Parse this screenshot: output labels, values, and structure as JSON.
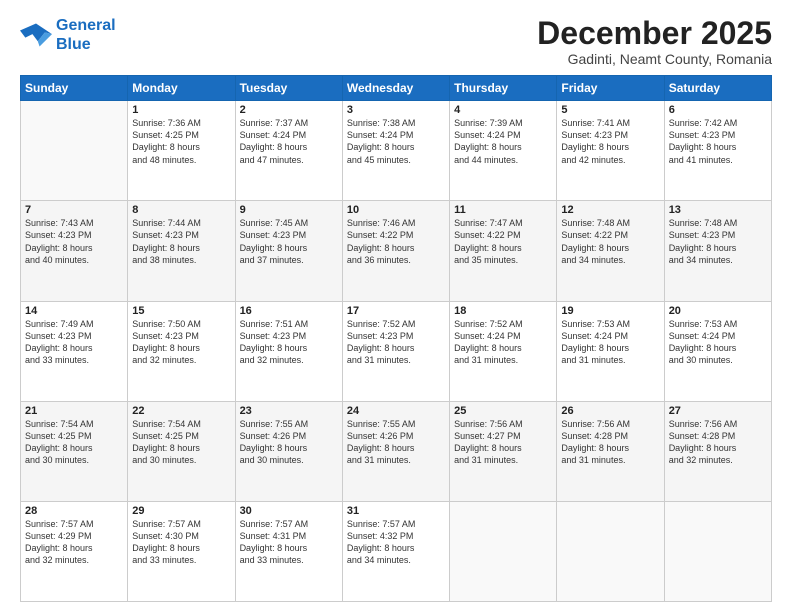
{
  "logo": {
    "line1": "General",
    "line2": "Blue"
  },
  "title": "December 2025",
  "subtitle": "Gadinti, Neamt County, Romania",
  "days_header": [
    "Sunday",
    "Monday",
    "Tuesday",
    "Wednesday",
    "Thursday",
    "Friday",
    "Saturday"
  ],
  "weeks": [
    [
      {
        "num": "",
        "info": ""
      },
      {
        "num": "1",
        "info": "Sunrise: 7:36 AM\nSunset: 4:25 PM\nDaylight: 8 hours\nand 48 minutes."
      },
      {
        "num": "2",
        "info": "Sunrise: 7:37 AM\nSunset: 4:24 PM\nDaylight: 8 hours\nand 47 minutes."
      },
      {
        "num": "3",
        "info": "Sunrise: 7:38 AM\nSunset: 4:24 PM\nDaylight: 8 hours\nand 45 minutes."
      },
      {
        "num": "4",
        "info": "Sunrise: 7:39 AM\nSunset: 4:24 PM\nDaylight: 8 hours\nand 44 minutes."
      },
      {
        "num": "5",
        "info": "Sunrise: 7:41 AM\nSunset: 4:23 PM\nDaylight: 8 hours\nand 42 minutes."
      },
      {
        "num": "6",
        "info": "Sunrise: 7:42 AM\nSunset: 4:23 PM\nDaylight: 8 hours\nand 41 minutes."
      }
    ],
    [
      {
        "num": "7",
        "info": "Sunrise: 7:43 AM\nSunset: 4:23 PM\nDaylight: 8 hours\nand 40 minutes."
      },
      {
        "num": "8",
        "info": "Sunrise: 7:44 AM\nSunset: 4:23 PM\nDaylight: 8 hours\nand 38 minutes."
      },
      {
        "num": "9",
        "info": "Sunrise: 7:45 AM\nSunset: 4:23 PM\nDaylight: 8 hours\nand 37 minutes."
      },
      {
        "num": "10",
        "info": "Sunrise: 7:46 AM\nSunset: 4:22 PM\nDaylight: 8 hours\nand 36 minutes."
      },
      {
        "num": "11",
        "info": "Sunrise: 7:47 AM\nSunset: 4:22 PM\nDaylight: 8 hours\nand 35 minutes."
      },
      {
        "num": "12",
        "info": "Sunrise: 7:48 AM\nSunset: 4:22 PM\nDaylight: 8 hours\nand 34 minutes."
      },
      {
        "num": "13",
        "info": "Sunrise: 7:48 AM\nSunset: 4:23 PM\nDaylight: 8 hours\nand 34 minutes."
      }
    ],
    [
      {
        "num": "14",
        "info": "Sunrise: 7:49 AM\nSunset: 4:23 PM\nDaylight: 8 hours\nand 33 minutes."
      },
      {
        "num": "15",
        "info": "Sunrise: 7:50 AM\nSunset: 4:23 PM\nDaylight: 8 hours\nand 32 minutes."
      },
      {
        "num": "16",
        "info": "Sunrise: 7:51 AM\nSunset: 4:23 PM\nDaylight: 8 hours\nand 32 minutes."
      },
      {
        "num": "17",
        "info": "Sunrise: 7:52 AM\nSunset: 4:23 PM\nDaylight: 8 hours\nand 31 minutes."
      },
      {
        "num": "18",
        "info": "Sunrise: 7:52 AM\nSunset: 4:24 PM\nDaylight: 8 hours\nand 31 minutes."
      },
      {
        "num": "19",
        "info": "Sunrise: 7:53 AM\nSunset: 4:24 PM\nDaylight: 8 hours\nand 31 minutes."
      },
      {
        "num": "20",
        "info": "Sunrise: 7:53 AM\nSunset: 4:24 PM\nDaylight: 8 hours\nand 30 minutes."
      }
    ],
    [
      {
        "num": "21",
        "info": "Sunrise: 7:54 AM\nSunset: 4:25 PM\nDaylight: 8 hours\nand 30 minutes."
      },
      {
        "num": "22",
        "info": "Sunrise: 7:54 AM\nSunset: 4:25 PM\nDaylight: 8 hours\nand 30 minutes."
      },
      {
        "num": "23",
        "info": "Sunrise: 7:55 AM\nSunset: 4:26 PM\nDaylight: 8 hours\nand 30 minutes."
      },
      {
        "num": "24",
        "info": "Sunrise: 7:55 AM\nSunset: 4:26 PM\nDaylight: 8 hours\nand 31 minutes."
      },
      {
        "num": "25",
        "info": "Sunrise: 7:56 AM\nSunset: 4:27 PM\nDaylight: 8 hours\nand 31 minutes."
      },
      {
        "num": "26",
        "info": "Sunrise: 7:56 AM\nSunset: 4:28 PM\nDaylight: 8 hours\nand 31 minutes."
      },
      {
        "num": "27",
        "info": "Sunrise: 7:56 AM\nSunset: 4:28 PM\nDaylight: 8 hours\nand 32 minutes."
      }
    ],
    [
      {
        "num": "28",
        "info": "Sunrise: 7:57 AM\nSunset: 4:29 PM\nDaylight: 8 hours\nand 32 minutes."
      },
      {
        "num": "29",
        "info": "Sunrise: 7:57 AM\nSunset: 4:30 PM\nDaylight: 8 hours\nand 33 minutes."
      },
      {
        "num": "30",
        "info": "Sunrise: 7:57 AM\nSunset: 4:31 PM\nDaylight: 8 hours\nand 33 minutes."
      },
      {
        "num": "31",
        "info": "Sunrise: 7:57 AM\nSunset: 4:32 PM\nDaylight: 8 hours\nand 34 minutes."
      },
      {
        "num": "",
        "info": ""
      },
      {
        "num": "",
        "info": ""
      },
      {
        "num": "",
        "info": ""
      }
    ]
  ]
}
